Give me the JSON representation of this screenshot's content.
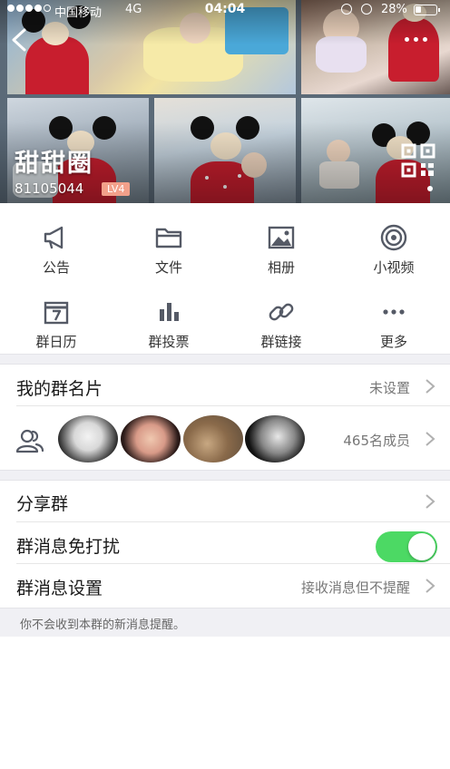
{
  "status_bar": {
    "carrier": "中国移动",
    "network": "4G",
    "time": "04:04",
    "battery": "28%",
    "battery_level": 0.28
  },
  "group": {
    "name": "甜甜圈",
    "id": "81105044",
    "level": "LV4"
  },
  "header_icons": {
    "back": "back-icon",
    "more": "more-icon",
    "qr": "qr-code-icon"
  },
  "features": [
    {
      "label": "公告",
      "icon": "megaphone-icon"
    },
    {
      "label": "文件",
      "icon": "folder-icon"
    },
    {
      "label": "相册",
      "icon": "album-icon"
    },
    {
      "label": "小视频",
      "icon": "video-icon"
    },
    {
      "label": "群日历",
      "icon": "calendar-icon"
    },
    {
      "label": "群投票",
      "icon": "vote-icon"
    },
    {
      "label": "群链接",
      "icon": "link-icon"
    },
    {
      "label": "更多",
      "icon": "more-icon"
    }
  ],
  "card": {
    "label": "我的群名片",
    "value": "未设置"
  },
  "members": {
    "count_label": "465名成员",
    "icon": "members-icon"
  },
  "share": {
    "label": "分享群"
  },
  "dnd": {
    "label": "群消息免打扰",
    "enabled": true
  },
  "message_settings": {
    "label": "群消息设置",
    "value": "接收消息但不提醒"
  },
  "footer_note": "你不会收到本群的新消息提醒。",
  "colors": {
    "toggle_on": "#4cd964",
    "level_badge": "#f2a08a",
    "icon_gray": "#555a66",
    "separator_bg": "#f0f0f4"
  }
}
